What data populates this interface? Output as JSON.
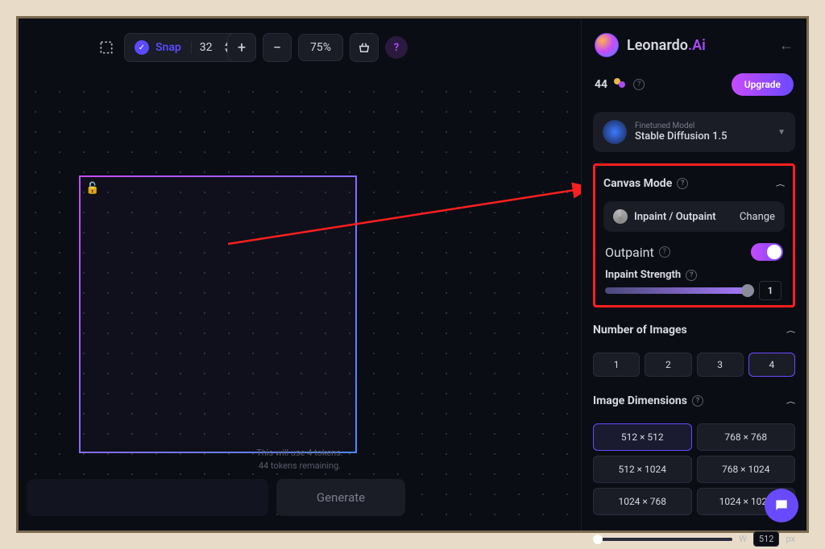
{
  "topbar": {
    "snap_label": "Snap",
    "snap_value": "32",
    "zoom_label": "75%"
  },
  "canvas": {
    "token_line1": "This will use 4 tokens.",
    "token_line2": "44 tokens remaining.",
    "generate": "Generate"
  },
  "sidebar": {
    "brand_pre": "Leonardo",
    "brand_suf": ".Ai",
    "tokens": "44",
    "upgrade": "Upgrade",
    "model_label": "Finetuned Model",
    "model_name": "Stable Diffusion 1.5",
    "canvas_mode_title": "Canvas Mode",
    "mode_label": "Inpaint / Outpaint",
    "change": "Change",
    "outpaint_label": "Outpaint",
    "strength_label": "Inpaint Strength",
    "strength_value": "1",
    "num_images_title": "Number of Images",
    "num_options": [
      "1",
      "2",
      "3",
      "4"
    ],
    "num_active": 3,
    "dim_title": "Image Dimensions",
    "dim_options": [
      "512 × 512",
      "768 × 768",
      "512 × 1024",
      "768 × 1024",
      "1024 × 768",
      "1024 × 1024"
    ],
    "dim_active": 0,
    "width_label": "W",
    "width_value": "512",
    "width_unit": "px"
  }
}
